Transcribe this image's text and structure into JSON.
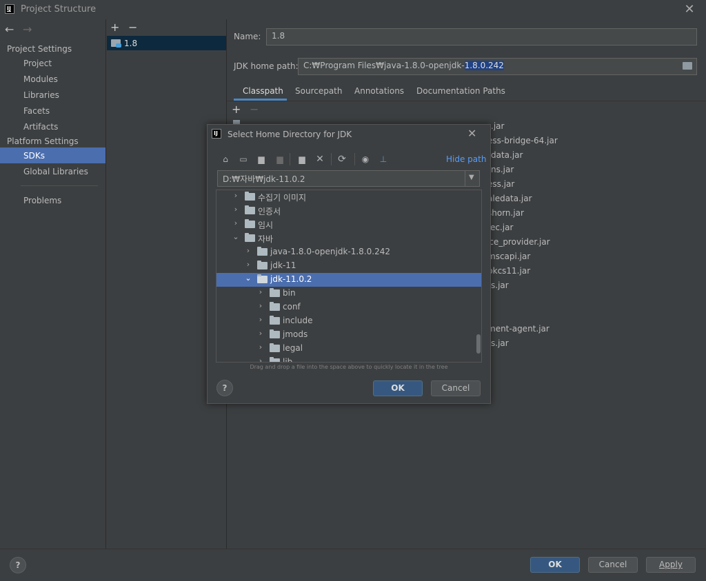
{
  "window": {
    "title": "Project Structure",
    "app_icon_text": "IJ"
  },
  "nav": {
    "back_icon": "arrow-left-icon",
    "forward_icon": "arrow-right-icon",
    "project_settings_header": "Project Settings",
    "project_items": [
      "Project",
      "Modules",
      "Libraries",
      "Facets",
      "Artifacts"
    ],
    "platform_settings_header": "Platform Settings",
    "platform_items": [
      "SDKs",
      "Global Libraries"
    ],
    "problems": "Problems",
    "selected": "SDKs"
  },
  "sdk_list": {
    "add": "+",
    "remove": "−",
    "items": [
      "1.8"
    ]
  },
  "form": {
    "name_label": "Name:",
    "name_value": "1.8",
    "home_label": "JDK home path:",
    "home_value_prefix": "C:₩Program Files₩java-1.8.0-openjdk-",
    "home_value_selected": "1.8.0.242",
    "tabs": [
      "Classpath",
      "Sourcepath",
      "Annotations",
      "Documentation Paths"
    ],
    "active_tab": "Classpath",
    "class_add": "+",
    "class_remove": "−",
    "jars": [
      ".jar",
      "ess-bridge-64.jar",
      "data.jar",
      "ns.jar",
      "ess.jar",
      "aledata.jar",
      "shorn.jar",
      "ec.jar",
      "ice_provider.jar",
      "mscapi.jar",
      "pkcs11.jar",
      "s.jar",
      "ment-agent.jar",
      "s.jar"
    ]
  },
  "dialog": {
    "title": "Select Home Directory for JDK",
    "hide_path": "Hide path",
    "path_value": "D:₩자바₩jdk-11.0.2",
    "toolbar_icons": [
      "home-icon",
      "desktop-icon",
      "project-folder-icon",
      "module-folder-icon",
      "new-folder-icon",
      "delete-icon",
      "refresh-icon",
      "show-hidden-icon",
      "link-icon"
    ],
    "tree": [
      {
        "label": "수집기 이미지",
        "level": 0,
        "expanded": false
      },
      {
        "label": "인증서",
        "level": 0,
        "expanded": false
      },
      {
        "label": "임시",
        "level": 0,
        "expanded": false
      },
      {
        "label": "자바",
        "level": 0,
        "expanded": true
      },
      {
        "label": "java-1.8.0-openjdk-1.8.0.242",
        "level": 1,
        "expanded": false
      },
      {
        "label": "jdk-11",
        "level": 1,
        "expanded": false
      },
      {
        "label": "jdk-11.0.2",
        "level": 1,
        "expanded": true,
        "selected": true
      },
      {
        "label": "bin",
        "level": 2,
        "expanded": false
      },
      {
        "label": "conf",
        "level": 2,
        "expanded": false
      },
      {
        "label": "include",
        "level": 2,
        "expanded": false
      },
      {
        "label": "jmods",
        "level": 2,
        "expanded": false
      },
      {
        "label": "legal",
        "level": 2,
        "expanded": false
      },
      {
        "label": "lib",
        "level": 2,
        "expanded": false
      }
    ],
    "hint": "Drag and drop a file into the space above to quickly locate it in the tree",
    "help": "?",
    "ok": "OK",
    "cancel": "Cancel"
  },
  "footer": {
    "help": "?",
    "ok": "OK",
    "cancel": "Cancel",
    "apply": "Apply"
  },
  "colors": {
    "selection": "#4b6eaf",
    "primary_button": "#365880",
    "link": "#589df6"
  }
}
